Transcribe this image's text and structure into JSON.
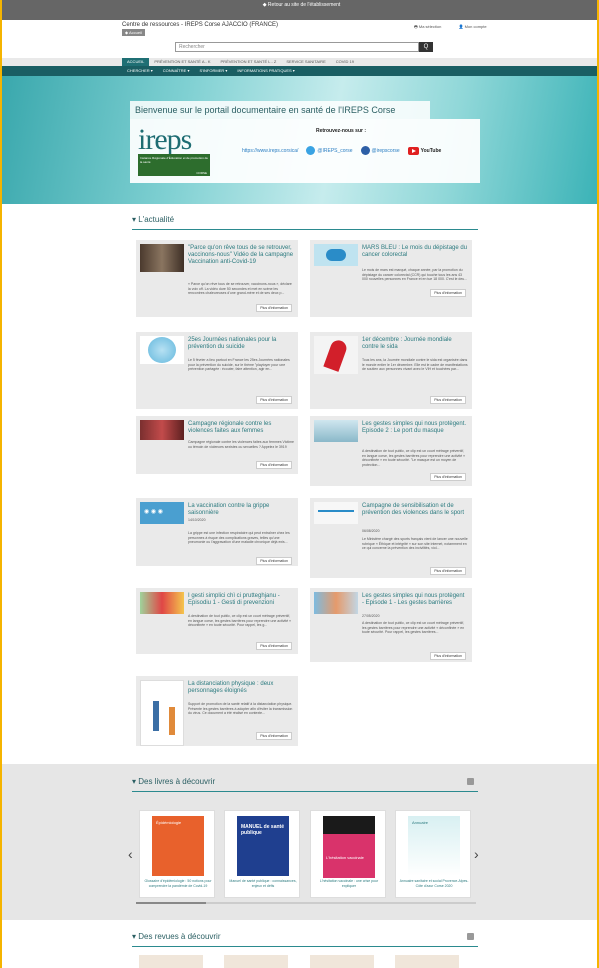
{
  "topbar": {
    "label": "◆ Retour au site de l'établissement"
  },
  "header": {
    "site_name": "Centre de ressources - IREPS Corse  AJACCIO (FRANCE)",
    "badge": "◆ Accueil",
    "selection": "Ma sélection",
    "account": "Mon compte"
  },
  "search": {
    "placeholder": "Rechercher",
    "button": "Q"
  },
  "nav_primary": [
    {
      "label": "ACCUEIL",
      "active": true
    },
    {
      "label": "PRÉVENTION ET SANTÉ A - K",
      "active": false
    },
    {
      "label": "PRÉVENTION ET SANTÉ L - Z",
      "active": false
    },
    {
      "label": "SERVICE SANITAIRE",
      "active": false
    },
    {
      "label": "COVID 19",
      "active": false
    }
  ],
  "nav_secondary": [
    {
      "label": "CHERCHER ▾"
    },
    {
      "label": "CONNAÎTRE ▾"
    },
    {
      "label": "S'INFORMER ▾"
    },
    {
      "label": "INFORMATIONS PRATIQUES ▾"
    }
  ],
  "hero": {
    "title": "Bienvenue sur le portail documentaire en santé de l'IREPS Corse",
    "logo_word": "ireps",
    "logo_sub": "Instance Régionale d'Éducation et de promotion de la santé",
    "logo_region": "CORSE",
    "social_heading": "Retrouvez-nous sur :",
    "website": "https://www.ireps.corsica/",
    "twitter": "@IREPS_corse",
    "facebook": "@irepscorse",
    "youtube": "YouTube"
  },
  "news": {
    "heading": "▾ L'actualité",
    "more_label": "Plus d'information",
    "items": [
      {
        "title": "\"Parce qu'on rêve tous de se retrouver, vaccinons-nous\" Vidéo de la campagne Vaccination anti-Covid-19",
        "text": "« Parce qu'on rêve tous de se retrouver, vaccinons-nous », déclare la voix off. La vidéo dure 50 secondes et met en scène les rencontres chaleureuses d'une grand-mère et de ses deux p..."
      },
      {
        "title": "MARS BLEU : Le mois du dépistage du cancer colorectal",
        "text": "Le mois de mars est marqué, chaque année, par la promotion du dépistage du cancer colorectal (CCR) qui touche tous les ans 43 000 nouvelles personnes en France et en tue 18 000. C'est le deu..."
      },
      {
        "title": "25es Journées nationales pour la prévention du suicide",
        "text": "Le 5 février a lieu partout en France les 25es Journées nationales pour la prévention du suicide, sur le thème \"playtoyer pour une prévention partagée : écouter, faire attention, agir en..."
      },
      {
        "title": "1er décembre : Journée mondiale contre le sida",
        "text": "Tous les ans, la Journée mondiale contre le sida est organisée dans le monde entier le 1er décembre. Elle est le cadre de manifestations de soutien aux personnes vivant avec le VIH et touchées par..."
      },
      {
        "title": "Campagne régionale contre les violences faites aux femmes",
        "text": "Campagne régionale contre les violences faites aux femmes Victime ou témoin de violences sexistes ou sexuelles ? Appelez le 3919"
      },
      {
        "title": "Les gestes simples qui nous protègent. Episode 2 : Le port du masque",
        "text": "A destination de tout public, ce clip est un court métrage préventif, en langue corse, les gestes barrières pour reprendre une activité « déconfinée » en toute sécurité. \"Le masque est un moyen de protection..."
      },
      {
        "title": "La vaccination contre la grippe saisonnière",
        "date": "14/10/2020",
        "text": "La grippe est une infection respiratoire qui peut entraîner chez les personnes à risque des complications graves, telles qu'une pneumonie ou l'aggravation d'une maladie chronique déjà exis..."
      },
      {
        "title": "Campagne de sensibilisation et de prévention des violences dans le sport",
        "date": "06/08/2020",
        "text": "Le Ministère chargé des sports français vient de lancer une nouvelle rubrique « Éthique et intégrité » sur son site internet, notamment en ce qui concerne la prévention des incivilités, viol..."
      },
      {
        "title": "I gesti simplici chì ci prutteghjanu - Episodiu 1 - Gesti di prevenzioni",
        "text": "A destination de tout public, ce clip est un court métrage préventif, en langue corse, les gestes barrières pour reprendre une activité « déconfinée » en toute sécurité. Pour rappel, les g..."
      },
      {
        "title": "Les gestes simples qui nous protègent - Episode 1 - Les gestes barrières",
        "date": "27/05/2020",
        "text": "A destination de tout public, ce clip est un court métrage préventif, les gestes barrières pour reprendre une activité « déconfinée » en toute sécurité. Pour rappel, les gestes barrières..."
      },
      {
        "title": "La distanciation physique : deux personnages éloignés",
        "text": "Support de promotion de la santé relatif à la distanciation physique. Présente les gestes barrières à adopter afin d'éviter la transmission du virus. Ce document a été réalisé en contexte..."
      }
    ]
  },
  "books": {
    "heading": "▾ Des livres à découvrir",
    "items": [
      {
        "title": "Épidémiologie",
        "caption": "Glossaire d'épidémiologie : 50 notions pour comprendre la pandémie de Covid-19"
      },
      {
        "title": "MANUEL de santé publique",
        "caption": "Manuel de santé publique : connaissances, enjeux et défis"
      },
      {
        "title": "L'hésitation vaccinale",
        "caption": "L'hésitation vaccinale : une crise pour expliquer"
      },
      {
        "title": "Annuaire",
        "caption": "Annuaire sanitaire et social Provence-Alpes-Côte d'azur Corse 2020"
      }
    ]
  },
  "journals": {
    "heading": "▾ Des revues à découvrir"
  },
  "colors": {
    "teal": "#1f6f74",
    "dark_teal": "#1a5e63",
    "title": "#2b7a7f"
  },
  "icons": [
    "search-icon",
    "rss-icon",
    "twitter-icon",
    "facebook-icon",
    "youtube-icon",
    "chevron-left-icon",
    "chevron-right-icon"
  ]
}
